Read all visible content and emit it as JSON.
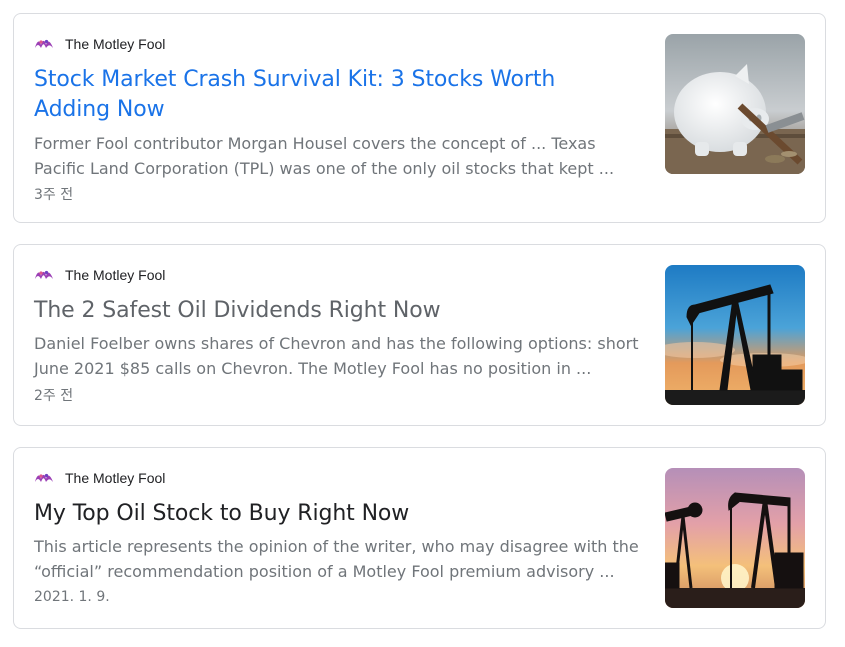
{
  "results": [
    {
      "source": "The Motley Fool",
      "title": "Stock Market Crash Survival Kit: 3 Stocks Worth Adding Now",
      "snippet": "Former Fool contributor Morgan Housel covers the concept of ... Texas Pacific Land Corporation (TPL) was one of the only oil stocks that kept ...",
      "date": "3주 전",
      "thumbnail": "piggy-bank-image"
    },
    {
      "source": "The Motley Fool",
      "title": "The 2 Safest Oil Dividends Right Now",
      "snippet": "Daniel Foelber owns shares of Chevron and has the following options: short June 2021 $85 calls on Chevron. The Motley Fool has no position in ...",
      "date": "2주 전",
      "thumbnail": "oil-pumpjack-sunset-image"
    },
    {
      "source": "The Motley Fool",
      "title": "My Top Oil Stock to Buy Right Now",
      "snippet": "This article represents the opinion of the writer, who may disagree with the “official” recommendation position of a Motley Fool premium advisory ...",
      "date": "2021. 1. 9.",
      "thumbnail": "oil-pumpjacks-dusk-image"
    }
  ],
  "colors": {
    "link_blue": "#1a73e8",
    "visited_gray": "#5f6368",
    "title_dark": "#202124",
    "snippet_gray": "#70757a",
    "logo_purple": "#8e44ad"
  }
}
